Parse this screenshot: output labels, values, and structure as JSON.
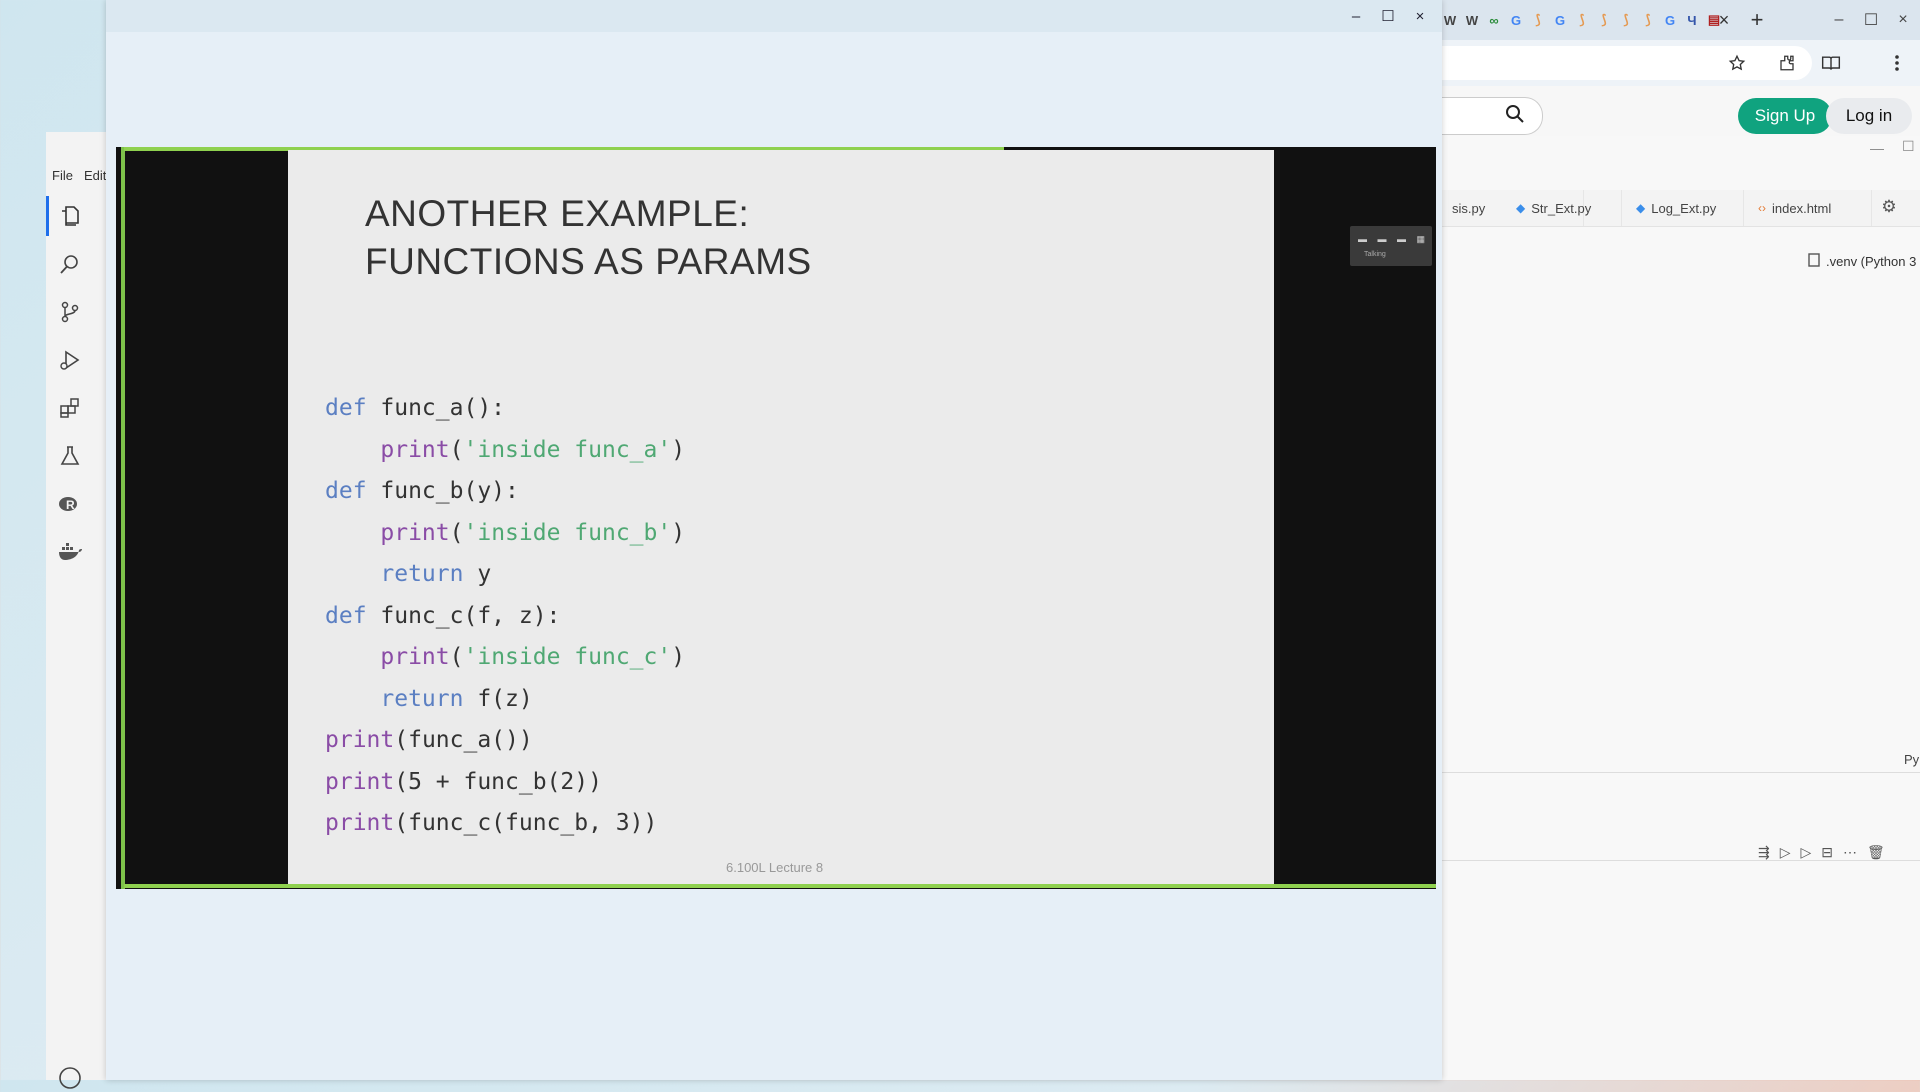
{
  "browser": {
    "favicon_row": [
      "W",
      "W",
      "∞",
      "G",
      "⟆",
      "G",
      "⟆",
      "⟆",
      "⟆",
      "⟆",
      "G",
      "Ч",
      "▤"
    ],
    "tab_close": "×",
    "new_tab": "+",
    "minimize": "–",
    "maximize": "☐",
    "close": "×",
    "signup_label": "Sign Up",
    "login_label": "Log in",
    "accent_color": "#10a37f"
  },
  "vscode": {
    "menu_file": "File",
    "menu_edit": "Edit",
    "tabs": [
      {
        "label": "sis.py",
        "icon": "python-file-icon"
      },
      {
        "label": "Str_Ext.py",
        "icon": "python-file-icon"
      },
      {
        "label": "Log_Ext.py",
        "icon": "python-file-icon"
      },
      {
        "label": "index.html",
        "icon": "html-file-icon"
      }
    ],
    "kernel": ".venv (Python 3",
    "py_label": "Py"
  },
  "video_window": {
    "minimize": "–",
    "maximize": "☐",
    "close": "×",
    "slide": {
      "title_line1": "ANOTHER EXAMPLE:",
      "title_line2": "FUNCTIONS AS PARAMS",
      "footer": "6.100L Lecture 8",
      "overlay_label": "Talking"
    }
  }
}
